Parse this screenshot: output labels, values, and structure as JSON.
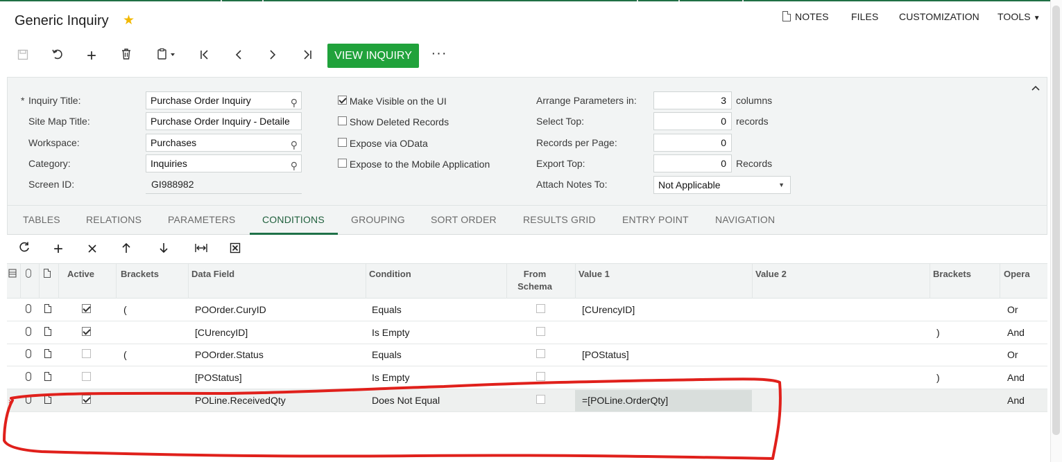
{
  "app": {
    "title": "Generic Inquiry",
    "header_links": [
      "NOTES",
      "FILES",
      "CUSTOMIZATION",
      "TOOLS"
    ],
    "toolbar": {
      "view_inquiry_label": "VIEW INQUIRY"
    }
  },
  "summary": {
    "inquiry_title": {
      "label": "Inquiry Title:",
      "required_mark": "*",
      "value": "Purchase Order Inquiry"
    },
    "site_map_title": {
      "label": "Site Map Title:",
      "value": "Purchase Order Inquiry - Detaile"
    },
    "workspace": {
      "label": "Workspace:",
      "value": "Purchases"
    },
    "category": {
      "label": "Category:",
      "value": "Inquiries"
    },
    "screen_id": {
      "label": "Screen ID:",
      "value": "GI988982"
    },
    "checkboxes": [
      {
        "label": "Make Visible on the UI",
        "checked": true
      },
      {
        "label": "Show Deleted Records",
        "checked": false
      },
      {
        "label": "Expose via OData",
        "checked": false
      },
      {
        "label": "Expose to the Mobile Application",
        "checked": false
      }
    ],
    "arrange_parameters": {
      "label": "Arrange Parameters in:",
      "value": "3",
      "suffix": "columns"
    },
    "select_top": {
      "label": "Select Top:",
      "value": "0",
      "suffix": "records"
    },
    "records_per_page": {
      "label": "Records per Page:",
      "value": "0"
    },
    "export_top": {
      "label": "Export Top:",
      "value": "0",
      "suffix": "Records"
    },
    "attach_notes_to": {
      "label": "Attach Notes To:",
      "value": "Not Applicable"
    }
  },
  "tabs": [
    "TABLES",
    "RELATIONS",
    "PARAMETERS",
    "CONDITIONS",
    "GROUPING",
    "SORT ORDER",
    "RESULTS GRID",
    "ENTRY POINT",
    "NAVIGATION"
  ],
  "active_tab": "CONDITIONS",
  "grid": {
    "headers": {
      "active": "Active",
      "brackets_open": "Brackets",
      "data_field": "Data Field",
      "condition": "Condition",
      "from_schema_1": "From",
      "from_schema_2": "Schema",
      "value1": "Value 1",
      "value2": "Value 2",
      "brackets_close": "Brackets",
      "operator": "Opera"
    },
    "rows": [
      {
        "active": true,
        "open": "(",
        "field": "POOrder.CuryID",
        "condition": "Equals",
        "from_schema": false,
        "value1": "[CUrencyID]",
        "value2": "",
        "close": "",
        "op": "Or"
      },
      {
        "active": true,
        "open": "",
        "field": "[CUrencyID]",
        "condition": "Is Empty",
        "from_schema": false,
        "value1": "",
        "value2": "",
        "close": ")",
        "op": "And"
      },
      {
        "active": false,
        "open": "(",
        "field": "POOrder.Status",
        "condition": "Equals",
        "from_schema": false,
        "value1": "[POStatus]",
        "value2": "",
        "close": "",
        "op": "Or"
      },
      {
        "active": false,
        "open": "",
        "field": "[POStatus]",
        "condition": "Is Empty",
        "from_schema": false,
        "value1": "",
        "value2": "",
        "close": ")",
        "op": "And"
      },
      {
        "active": true,
        "open": "",
        "field": "POLine.ReceivedQty",
        "condition": "Does Not Equal",
        "from_schema": false,
        "value1": "=[POLine.OrderQty]",
        "value2": "",
        "close": "",
        "op": "And"
      }
    ]
  },
  "colors": {
    "accent_green": "#20a23b",
    "tab_active": "#1f5f3c",
    "annotation_red": "#e0201b",
    "star": "#f2b800"
  }
}
